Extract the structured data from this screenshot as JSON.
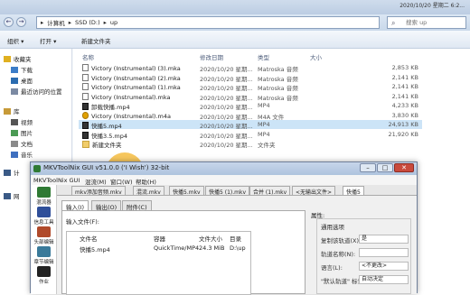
{
  "explorer": {
    "datestamp": "2020/10/20 星期二 6:2...",
    "nav_back": "←",
    "nav_fwd": "→",
    "address_parts": [
      "计算机",
      "SSD (D:)",
      "up"
    ],
    "search_placeholder": "搜索 up",
    "toolbar": {
      "organize": "组织 ▾",
      "open": "打开 ▾",
      "new_folder": "新建文件夹"
    },
    "nav_items": [
      {
        "label": "收藏夹",
        "icon": "star-icon"
      },
      {
        "label": "下载",
        "icon": "download-folder-icon"
      },
      {
        "label": "桌面",
        "icon": "desktop-icon"
      },
      {
        "label": "最近访问的位置",
        "icon": "recent-places-icon"
      },
      {
        "label": "库",
        "icon": "library-icon"
      },
      {
        "label": "视频",
        "icon": "video-library-icon"
      },
      {
        "label": "图片",
        "icon": "picture-library-icon"
      },
      {
        "label": "文档",
        "icon": "document-library-icon"
      },
      {
        "label": "音乐",
        "icon": "music-library-icon"
      },
      {
        "label": "计",
        "icon": "computer-icon"
      },
      {
        "label": "网",
        "icon": "network-icon"
      }
    ],
    "columns": {
      "name": "名称",
      "date": "修改日期",
      "type": "类型",
      "size": "大小"
    },
    "files": [
      {
        "name": "Victory (Instrumental) (3).mka",
        "date": "2020/10/20 星期...",
        "type": "Matroska 音频",
        "size": "2,853 KB",
        "kind": "audio-file-icon"
      },
      {
        "name": "Victory (Instrumental) (2).mka",
        "date": "2020/10/20 星期...",
        "type": "Matroska 音频",
        "size": "2,141 KB",
        "kind": "audio-file-icon"
      },
      {
        "name": "Victory (Instrumental) (1).mka",
        "date": "2020/10/20 星期...",
        "type": "Matroska 音频",
        "size": "2,141 KB",
        "kind": "audio-file-icon"
      },
      {
        "name": "Victory (Instrumental).mka",
        "date": "2020/10/20 星期...",
        "type": "Matroska 音频",
        "size": "2,141 KB",
        "kind": "audio-file-icon"
      },
      {
        "name": "卸载快播.mp4",
        "date": "2020/10/20 星期...",
        "type": "MP4",
        "size": "4,233 KB",
        "kind": "video-file-icon"
      },
      {
        "name": "Victory (Instrumental).m4a",
        "date": "2020/10/20 星期...",
        "type": "M4A 文件",
        "size": "3,830 KB",
        "kind": "m4a-file-icon"
      },
      {
        "name": "快播5.mp4",
        "date": "2020/10/20 星期...",
        "type": "MP4",
        "size": "24,913 KB",
        "kind": "video-file-icon"
      },
      {
        "name": "快播3.5.mp4",
        "date": "2020/10/20 星期...",
        "type": "MP4",
        "size": "21,920 KB",
        "kind": "video-file-icon"
      },
      {
        "name": "新建文件夹",
        "date": "2020/10/20 星期...",
        "type": "文件夹",
        "size": "",
        "kind": "folder-icon"
      }
    ],
    "selected_index": 6
  },
  "mkv": {
    "title": "MKVToolNix GUI v51.0.0 ('I Wish') 32-bit",
    "menu": [
      "MKVToolNix GUI",
      "混流(M)",
      "窗口(W)",
      "帮助(H)"
    ],
    "side": [
      {
        "label": "混流器"
      },
      {
        "label": "信息工具"
      },
      {
        "label": "头部编辑器"
      },
      {
        "label": "章节编辑器"
      },
      {
        "label": "作业"
      }
    ],
    "file_tabs": [
      "mkv添加音频.mkv",
      "混流.mkv",
      "快播5.mkv",
      "快播5 (1).mkv",
      "合并 (1).mkv",
      "<无输出文件>",
      "快播5"
    ],
    "sub_tabs": [
      "输入(I)",
      "输出(O)",
      "附件(C)"
    ],
    "input_files_label": "输入文件(F):",
    "table_headers": [
      "文件名",
      "容器",
      "文件大小",
      "目录"
    ],
    "table_row": [
      "快播5.mp4",
      "QuickTime/MP4",
      "24.3 MiB",
      "D:\\up"
    ],
    "props_label": "属性:",
    "group_title": "通用选项",
    "props": [
      {
        "label": "复制该轨道(X):",
        "value": "是"
      },
      {
        "label": "轨道名称(N):",
        "value": ""
      },
      {
        "label": "语言(L):",
        "value": "<不更改>"
      },
      {
        "label": "\"默认轨道\" 标记:",
        "value": "自动决定"
      }
    ]
  },
  "colors": {
    "selection": "#cce4f7",
    "accent": "#2f7a34",
    "highlight": "#f4b428"
  }
}
